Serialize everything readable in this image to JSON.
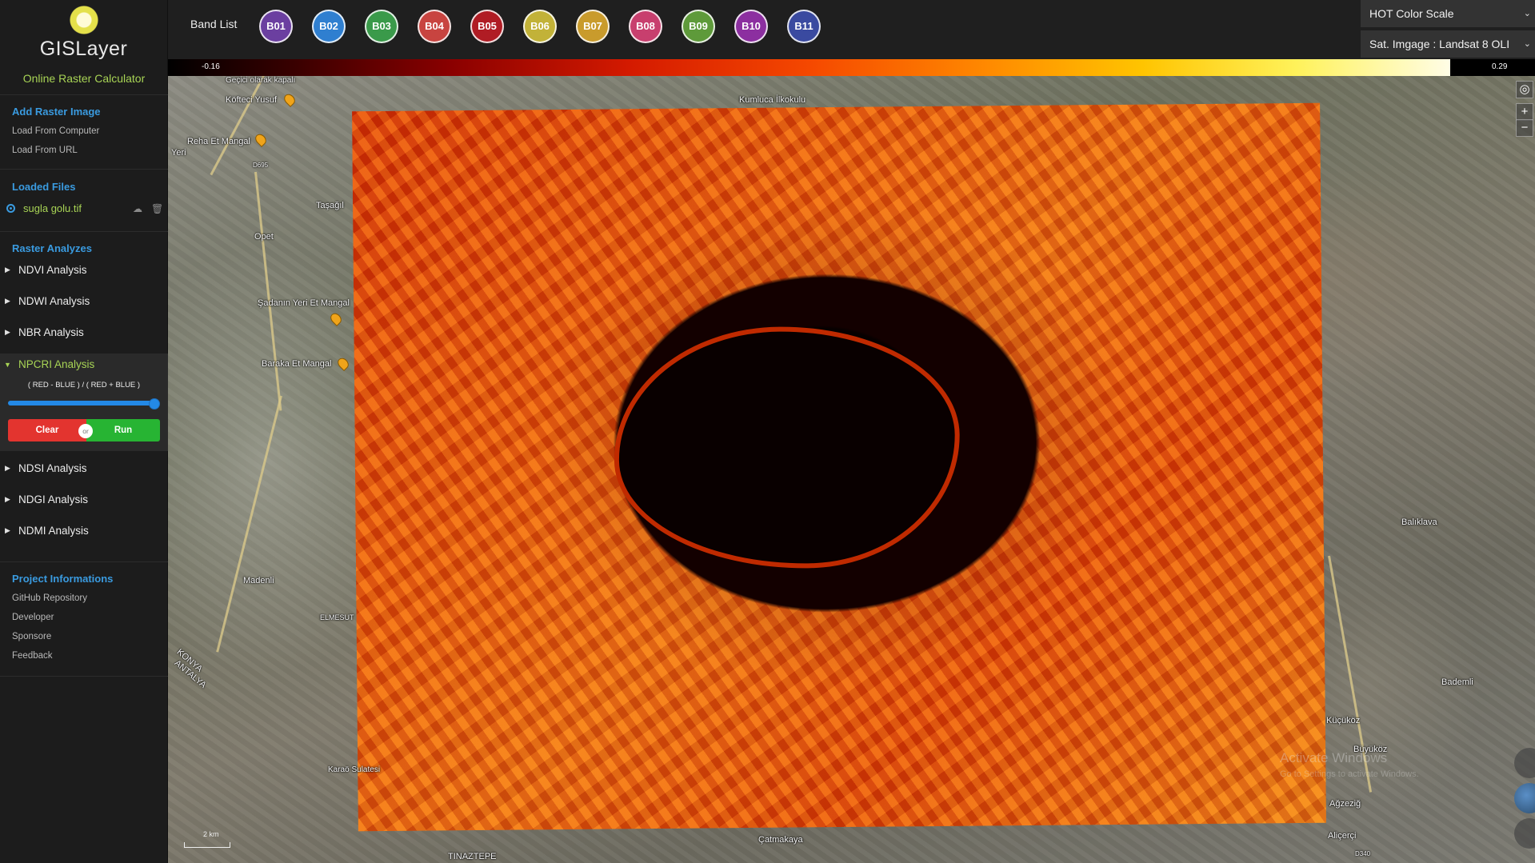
{
  "app": {
    "brand": "GISLayer",
    "tagline": "Online Raster Calculator"
  },
  "sidebar": {
    "add_raster": {
      "title": "Add Raster Image",
      "items": [
        "Load From Computer",
        "Load From URL"
      ]
    },
    "loaded_files": {
      "title": "Loaded Files",
      "file": "sugla golu.tif"
    },
    "raster_analyzes": {
      "title": "Raster Analyzes",
      "items": [
        "NDVI Analysis",
        "NDWI Analysis",
        "NBR Analysis",
        "NPCRI Analysis",
        "NDSI Analysis",
        "NDGI Analysis",
        "NDMI Analysis"
      ],
      "expanded": {
        "label": "NPCRI Analysis",
        "formula": "( RED - BLUE ) / ( RED + BLUE )",
        "slider_fraction": 1.0,
        "clear_label": "Clear",
        "or_label": "or",
        "run_label": "Run"
      }
    },
    "project": {
      "title": "Project Informations",
      "items": [
        "GitHub Repository",
        "Developer",
        "Sponsore",
        "Feedback"
      ]
    }
  },
  "topbar": {
    "band_list_label": "Band List",
    "bands": [
      {
        "label": "B01",
        "color": "#6b3fa0"
      },
      {
        "label": "B02",
        "color": "#2f7fd0"
      },
      {
        "label": "B03",
        "color": "#3a9a4a"
      },
      {
        "label": "B04",
        "color": "#c84440"
      },
      {
        "label": "B05",
        "color": "#b01c24"
      },
      {
        "label": "B06",
        "color": "#c2b238"
      },
      {
        "label": "B07",
        "color": "#c99b2c"
      },
      {
        "label": "B08",
        "color": "#c83f6e"
      },
      {
        "label": "B09",
        "color": "#5e9a3a"
      },
      {
        "label": "B10",
        "color": "#8c2fa0"
      },
      {
        "label": "B11",
        "color": "#3a4aa0"
      }
    ],
    "color_scale_select": "HOT Color Scale",
    "sat_image_select": "Sat. Imgage : Landsat 8 OLI"
  },
  "colorbar": {
    "min": "-0.16",
    "max": "0.29"
  },
  "map": {
    "labels": [
      "Geçici olarak kapalı",
      "Köfteci Yusuf",
      "Kumluca İlkokulu",
      "Reha Et Mangal",
      "Yeri",
      "Taşağıl",
      "Opet",
      "Şadanın Yeri Et Mangal",
      "Baraka Et Mangal",
      "Madenli",
      "ELMESUT",
      "KONYA",
      "ANTALYA",
      "Karaö Sulatesi",
      "TINAZTEPE",
      "Çatmakaya",
      "Balıklava",
      "Bademli",
      "Küçüköz",
      "Büyüköz",
      "Ağzeziğ",
      "Aliçerçi",
      "D695",
      "D340"
    ],
    "watermark": "Activate Windows",
    "watermark_sub": "Go to Settings to activate Windows.",
    "scale_text": "2 km"
  }
}
